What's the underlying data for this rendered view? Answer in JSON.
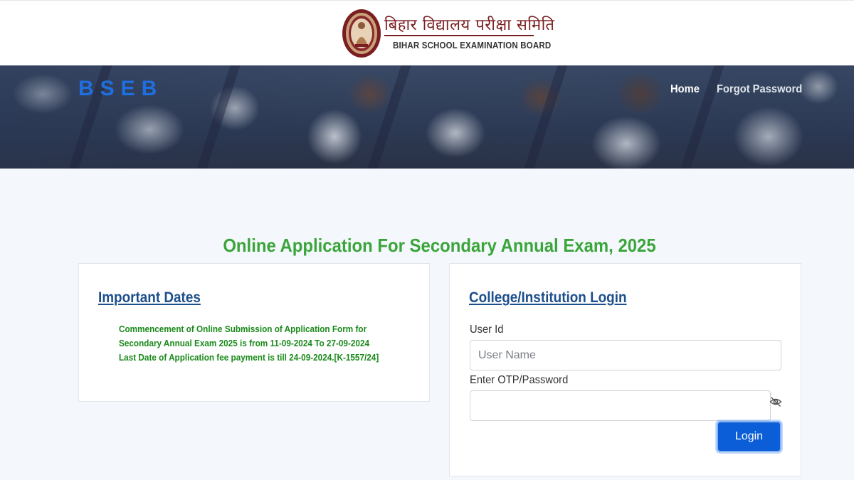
{
  "header": {
    "title_hindi": "बिहार विद्यालय परीक्षा समिति",
    "title_english": "BIHAR SCHOOL EXAMINATION BOARD",
    "logo_icon": "bseb-seal-icon"
  },
  "banner": {
    "logo_text": "BSEB",
    "nav": {
      "home": "Home",
      "forgot_password": "Forgot Password"
    }
  },
  "page": {
    "title": "Online Application For Secondary Annual Exam, 2025"
  },
  "important_dates": {
    "heading": "Important Dates",
    "lines": [
      "Commencement of Online Submission of Application Form for Secondary Annual Exam 2025 is from 11-09-2024 To 27-09-2024",
      "Last Date of Application fee payment is till 24-09-2024.[K-1557/24]"
    ]
  },
  "login": {
    "heading": "College/Institution Login",
    "user_id_label": "User Id",
    "user_id_placeholder": "User Name",
    "password_label": "Enter OTP/Password",
    "password_toggle_icon": "eye-slash-icon",
    "login_button": "Login"
  },
  "colors": {
    "title_green": "#3aa53a",
    "dates_green": "#1a8a1a",
    "heading_blue": "#1d4f8c",
    "brand_blue": "#1f6fe0",
    "button_blue": "#0b5ed7",
    "seal_maroon": "#7a1e22"
  }
}
